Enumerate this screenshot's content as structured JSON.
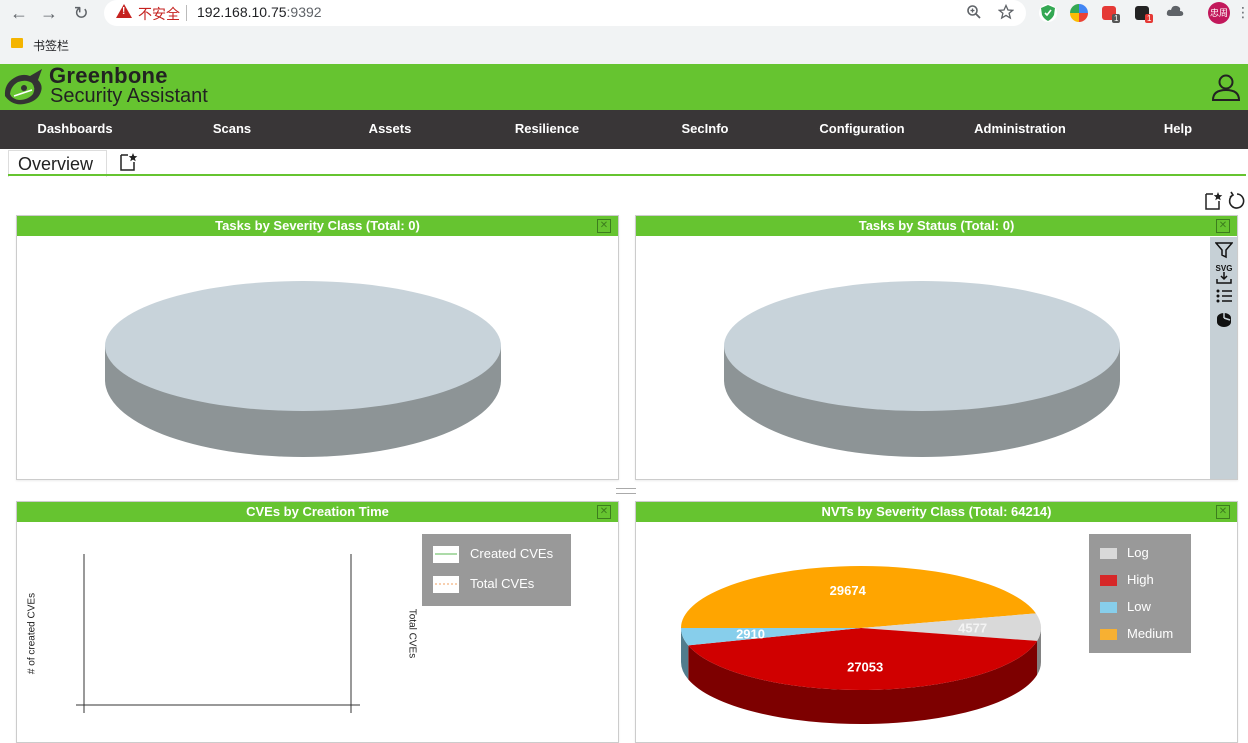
{
  "browser": {
    "nav": {
      "back": "←",
      "forward": "→",
      "reload": "↻"
    },
    "address": {
      "insecure_label": "不安全",
      "host": "192.168.10.75",
      "port": ":9392"
    },
    "extensions": {
      "badge_1": "1",
      "badge_2": "1"
    },
    "profile_label": "忠周",
    "bookmarks": [
      {
        "label": "书签栏"
      }
    ]
  },
  "gsa": {
    "brand_title": "Greenbone",
    "brand_subtitle": "Security Assistant",
    "nav": [
      {
        "label": "Dashboards"
      },
      {
        "label": "Scans"
      },
      {
        "label": "Assets"
      },
      {
        "label": "Resilience"
      },
      {
        "label": "SecInfo"
      },
      {
        "label": "Configuration"
      },
      {
        "label": "Administration"
      },
      {
        "label": "Help"
      }
    ],
    "tabs": [
      {
        "label": "Overview"
      }
    ],
    "colors": {
      "brand": "#66c430",
      "nav_bg": "#393637",
      "empty_pie_top": "#c8d3da",
      "empty_pie_side": "#8d9496"
    }
  },
  "panels": [
    {
      "title": "Tasks by Severity Class (Total: 0)"
    },
    {
      "title": "Tasks by Status (Total: 0)",
      "toolbar": {
        "svg_label": "SVG"
      }
    },
    {
      "title": "CVEs by Creation Time",
      "legend": [
        {
          "label": "Created CVEs"
        },
        {
          "label": "Total CVEs"
        }
      ],
      "y_left_label": "# of created CVEs",
      "y_right_label": "Total CVEs"
    },
    {
      "title": "NVTs by Severity Class (Total: 64214)",
      "legend": [
        {
          "label": "Log",
          "color": "#d9d9d9"
        },
        {
          "label": "High",
          "color": "#d62728"
        },
        {
          "label": "Low",
          "color": "#87ceeb"
        },
        {
          "label": "Medium",
          "color": "#f7b032"
        }
      ]
    }
  ],
  "chart_data": [
    {
      "type": "pie",
      "title": "Tasks by Severity Class (Total: 0)",
      "values": [],
      "empty": true
    },
    {
      "type": "pie",
      "title": "Tasks by Status (Total: 0)",
      "values": [],
      "empty": true
    },
    {
      "type": "line",
      "title": "CVEs by Creation Time",
      "series": [
        {
          "name": "Created CVEs",
          "values": []
        },
        {
          "name": "Total CVEs",
          "values": []
        }
      ],
      "ylabel": "# of created CVEs",
      "y2label": "Total CVEs",
      "legend": "top-right"
    },
    {
      "type": "pie",
      "title": "NVTs by Severity Class (Total: 64214)",
      "categories": [
        "Medium",
        "Log",
        "High",
        "Low"
      ],
      "values": [
        29674,
        4577,
        27053,
        2910
      ],
      "colors": [
        "#ffa500",
        "#d9d9d9",
        "#d00000",
        "#87ceeb"
      ],
      "legend": "top-right"
    }
  ]
}
